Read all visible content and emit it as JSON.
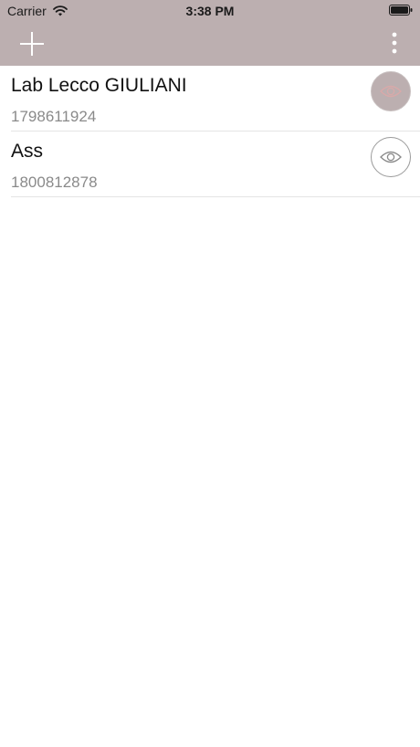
{
  "status_bar": {
    "carrier": "Carrier",
    "time": "3:38 PM",
    "wifi_icon": "wifi-icon",
    "battery_icon": "battery-icon"
  },
  "nav_bar": {
    "background_color": "#bcafb0",
    "add_icon": "plus-icon",
    "menu_icon": "more-vertical-icon"
  },
  "contacts": [
    {
      "name": "Lab Lecco GIULIANI",
      "number": "1798611924",
      "view_icon": "eye-icon",
      "view_state": "active"
    },
    {
      "name": "Ass",
      "number": "1800812878",
      "view_icon": "eye-icon",
      "view_state": "inactive"
    }
  ]
}
